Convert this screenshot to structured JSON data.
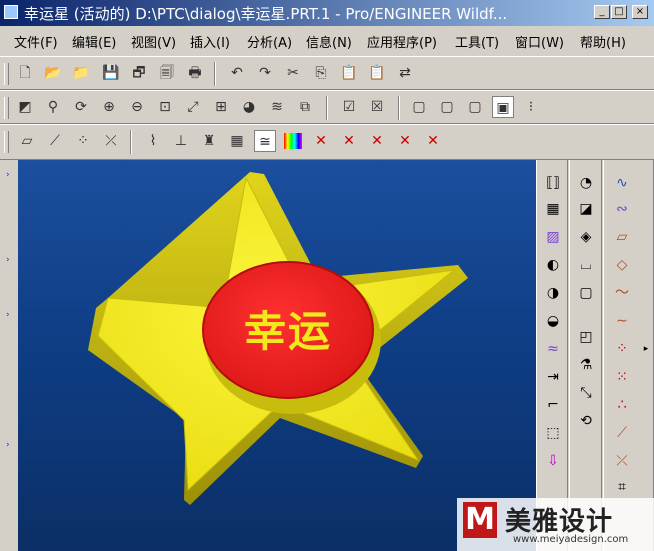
{
  "window": {
    "title": "幸运星 (活动的) D:\\PTC\\dialog\\幸运星.PRT.1 - Pro/ENGINEER Wildf...",
    "minimize": "_",
    "maximize": "□",
    "close": "×"
  },
  "menu": [
    {
      "label": "文件(F)"
    },
    {
      "label": "编辑(E)"
    },
    {
      "label": "视图(V)"
    },
    {
      "label": "插入(I)"
    },
    {
      "label": "分析(A)"
    },
    {
      "label": "信息(N)"
    },
    {
      "label": "应用程序(P)"
    },
    {
      "label": "工具(T)"
    },
    {
      "label": "窗口(W)"
    },
    {
      "label": "帮助(H)"
    }
  ],
  "model": {
    "badge_text": "幸运",
    "star_color": "#f2e81c",
    "star_side_color": "#bdb10a",
    "badge_color": "#ee1d1d",
    "badge_text_color": "#f2e81c"
  },
  "watermark": {
    "logo_letter": "M",
    "brand": "美雅设计",
    "url": "www.meiyadesign.com"
  },
  "colors": {
    "title_bar_start": "#0a246a",
    "title_bar_end": "#a6caf0",
    "viewport_top": "#1c4f9e",
    "viewport_bottom": "#0b2f66"
  }
}
